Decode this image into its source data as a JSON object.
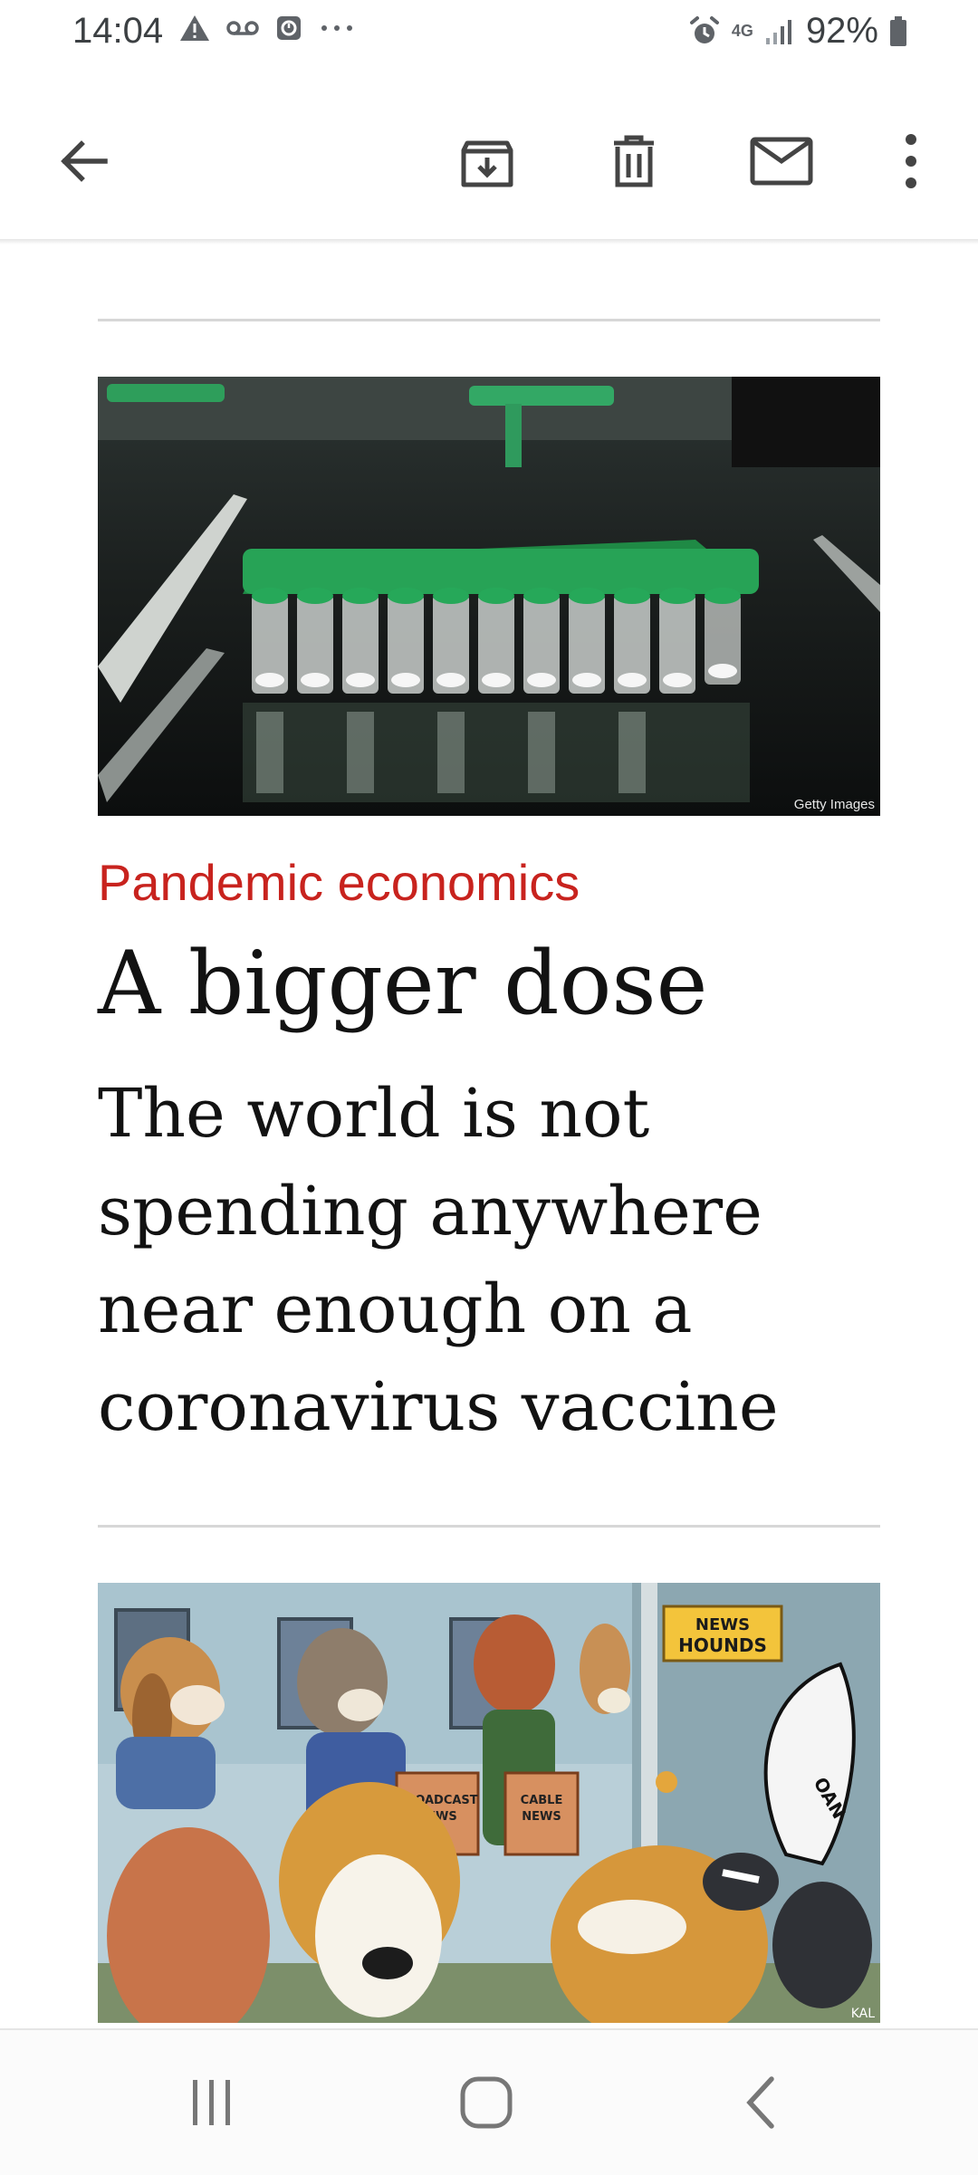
{
  "status_bar": {
    "time": "14:04",
    "left_icons": [
      "warning-icon",
      "voicemail-icon",
      "alarm-clock-app-icon",
      "more-dots-icon"
    ],
    "network": "4G",
    "battery": "92%"
  },
  "toolbar": {
    "icons": [
      "back-arrow-icon",
      "archive-icon",
      "delete-icon",
      "mark-unread-icon",
      "more-vert-icon"
    ]
  },
  "article": {
    "image_credit": "Getty Images",
    "kicker": "Pandemic economics",
    "headline": "A bigger dose",
    "standfirst": "The world is not spending anywhere near enough on a coronavirus vaccine"
  },
  "cartoon": {
    "sign": "NEWS HOUNDS",
    "chair_left": "BROADCAST NEWS",
    "chair_right": "CABLE NEWS",
    "tail_label": "OAN",
    "signature": "KAL"
  },
  "nav_bar": {
    "icons": [
      "recent-apps-icon",
      "home-icon",
      "back-icon"
    ]
  },
  "colors": {
    "kicker": "#c8231e",
    "text": "#121212",
    "divider": "#d7d7d7"
  }
}
